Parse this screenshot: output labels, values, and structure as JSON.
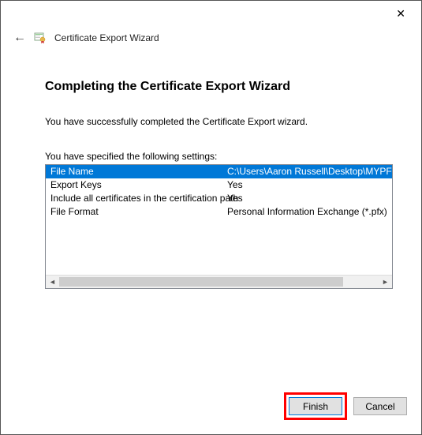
{
  "window": {
    "wizard_title": "Certificate Export Wizard"
  },
  "page": {
    "heading": "Completing the Certificate Export Wizard",
    "success_text": "You have successfully completed the Certificate Export wizard.",
    "settings_label": "You have specified the following settings:"
  },
  "settings": {
    "rows": [
      {
        "label": "File Name",
        "value": "C:\\Users\\Aaron Russell\\Desktop\\MYPF"
      },
      {
        "label": "Export Keys",
        "value": "Yes"
      },
      {
        "label": "Include all certificates in the certification path",
        "value": "Yes"
      },
      {
        "label": "File Format",
        "value": "Personal Information Exchange (*.pfx)"
      }
    ]
  },
  "buttons": {
    "finish": "Finish",
    "cancel": "Cancel"
  }
}
